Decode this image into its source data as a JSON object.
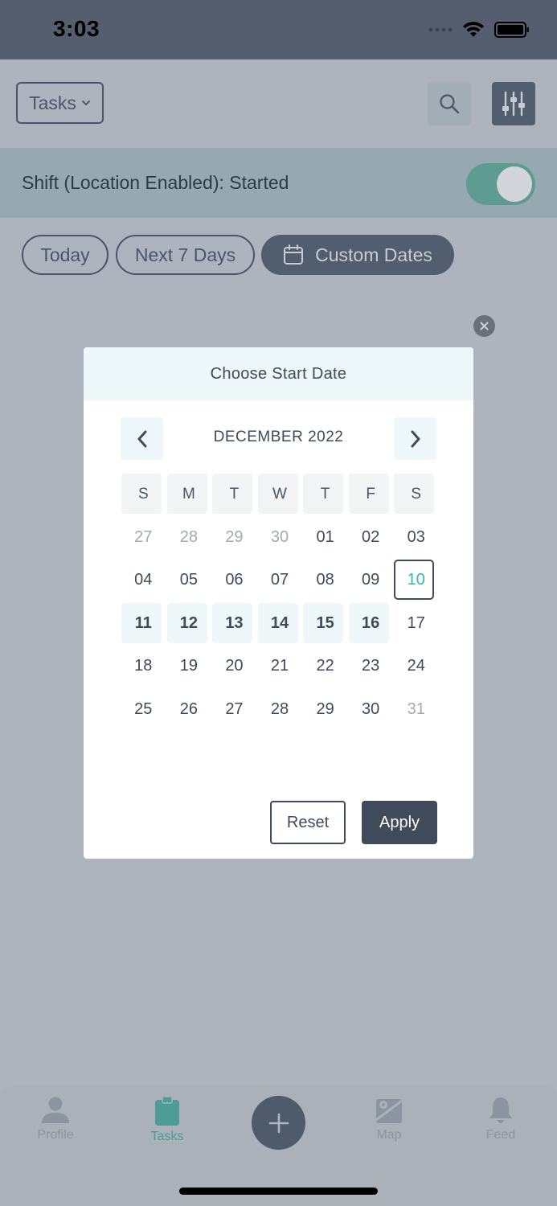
{
  "status_bar": {
    "time": "3:03"
  },
  "header": {
    "view_selector": "Tasks"
  },
  "shift": {
    "label": "Shift (Location Enabled): Started",
    "enabled": true
  },
  "filters": {
    "today": "Today",
    "next7": "Next 7 Days",
    "custom": "Custom Dates"
  },
  "modal": {
    "title": "Choose Start Date",
    "month": "DECEMBER 2022",
    "weekdays": [
      "S",
      "M",
      "T",
      "W",
      "T",
      "F",
      "S"
    ],
    "weeks": [
      [
        {
          "d": "27",
          "s": "muted"
        },
        {
          "d": "28",
          "s": "muted"
        },
        {
          "d": "29",
          "s": "muted"
        },
        {
          "d": "30",
          "s": "muted"
        },
        {
          "d": "01",
          "s": ""
        },
        {
          "d": "02",
          "s": ""
        },
        {
          "d": "03",
          "s": ""
        }
      ],
      [
        {
          "d": "04",
          "s": ""
        },
        {
          "d": "05",
          "s": ""
        },
        {
          "d": "06",
          "s": ""
        },
        {
          "d": "07",
          "s": ""
        },
        {
          "d": "08",
          "s": ""
        },
        {
          "d": "09",
          "s": ""
        },
        {
          "d": "10",
          "s": "selected"
        }
      ],
      [
        {
          "d": "11",
          "s": "range"
        },
        {
          "d": "12",
          "s": "range"
        },
        {
          "d": "13",
          "s": "range"
        },
        {
          "d": "14",
          "s": "range"
        },
        {
          "d": "15",
          "s": "range"
        },
        {
          "d": "16",
          "s": "range"
        },
        {
          "d": "17",
          "s": ""
        }
      ],
      [
        {
          "d": "18",
          "s": ""
        },
        {
          "d": "19",
          "s": ""
        },
        {
          "d": "20",
          "s": ""
        },
        {
          "d": "21",
          "s": ""
        },
        {
          "d": "22",
          "s": ""
        },
        {
          "d": "23",
          "s": ""
        },
        {
          "d": "24",
          "s": ""
        }
      ],
      [
        {
          "d": "25",
          "s": ""
        },
        {
          "d": "26",
          "s": ""
        },
        {
          "d": "27",
          "s": ""
        },
        {
          "d": "28",
          "s": ""
        },
        {
          "d": "29",
          "s": ""
        },
        {
          "d": "30",
          "s": ""
        },
        {
          "d": "31",
          "s": "muted"
        }
      ]
    ],
    "reset": "Reset",
    "apply": "Apply"
  },
  "tabbar": {
    "profile": "Profile",
    "tasks": "Tasks",
    "map": "Map",
    "feed": "Feed"
  },
  "colors": {
    "accent": "#2fb8ad",
    "dark": "#3f4a5a",
    "toggle": "#5e9c92"
  }
}
